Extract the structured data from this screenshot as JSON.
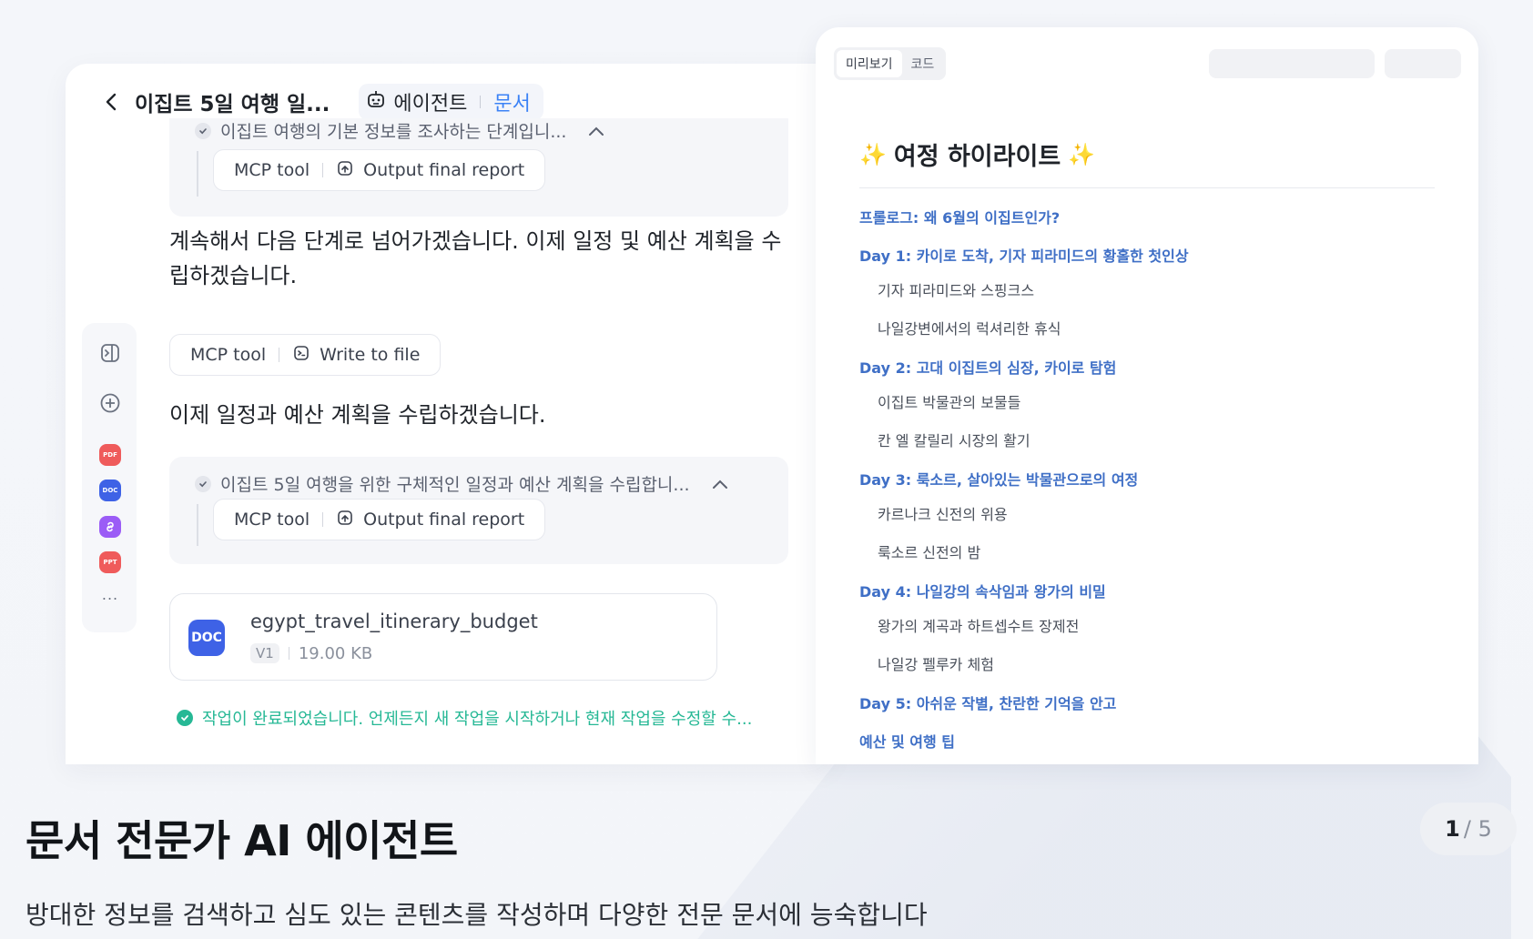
{
  "chat": {
    "title": "이집트 5일 여행 일...",
    "mode_agent": "에이전트",
    "mode_doc": "문서",
    "step1_text": "이집트 여행의 기본 정보를 조사하는 단계입니...",
    "step1_tool": "Output final report",
    "message1": "계속해서 다음 단계로 넘어가겠습니다. 이제 일정 및 예산 계획을 수립하겠습니다.",
    "tool2": "Write to file",
    "message2": "이제 일정과 예산 계획을 수립하겠습니다.",
    "step2_text": "이집트 5일 여행을 위한 구체적인 일정과 예산 계획을 수립합니...",
    "step2_tool": "Output final report",
    "mcp_label": "MCP tool",
    "file": {
      "name": "egypt_travel_itinerary_budget",
      "type": "DOC",
      "version": "V1",
      "size": "19.00 KB"
    },
    "done_text": "작업이 완료되었습니다. 언제든지 새 작업을 시작하거나 현재 작업을 수정할 수..."
  },
  "rail": {
    "files": [
      {
        "label": "PDF",
        "color": "#ef5b5b"
      },
      {
        "label": "DOC",
        "color": "#3e62e6"
      },
      {
        "label": "LINK",
        "color": "#9b5cf6"
      },
      {
        "label": "PPT",
        "color": "#ef5b5b"
      }
    ],
    "more": "..."
  },
  "preview": {
    "tab_preview": "미리보기",
    "tab_code": "코드",
    "title": "여정 하이라이트",
    "toc": [
      {
        "level": 1,
        "text": "프롤로그: 왜 6월의 이집트인가?"
      },
      {
        "level": 1,
        "text": "Day 1: 카이로 도착, 기자 피라미드의 황홀한 첫인상"
      },
      {
        "level": 2,
        "text": "기자 피라미드와 스핑크스"
      },
      {
        "level": 2,
        "text": "나일강변에서의 럭셔리한 휴식"
      },
      {
        "level": 1,
        "text": "Day 2: 고대 이집트의 심장, 카이로 탐험"
      },
      {
        "level": 2,
        "text": "이집트 박물관의 보물들"
      },
      {
        "level": 2,
        "text": "칸 엘 칼릴리 시장의 활기"
      },
      {
        "level": 1,
        "text": "Day 3: 룩소르, 살아있는 박물관으로의 여정"
      },
      {
        "level": 2,
        "text": "카르나크 신전의 위용"
      },
      {
        "level": 2,
        "text": "룩소르 신전의 밤"
      },
      {
        "level": 1,
        "text": "Day 4: 나일강의 속삭임과 왕가의 비밀"
      },
      {
        "level": 2,
        "text": "왕가의 계곡과 하트셉수트 장제전"
      },
      {
        "level": 2,
        "text": "나일강 펠루카 체험"
      },
      {
        "level": 1,
        "text": "Day 5: 아쉬운 작별, 찬란한 기억을 안고"
      },
      {
        "level": 1,
        "text": "예산 및 여행 팁"
      }
    ]
  },
  "caption": {
    "title": "문서 전문가 AI 에이전트",
    "subtitle": "방대한 정보를 검색하고 심도 있는 콘텐츠를 작성하며 다양한 전문 문서에 능숙합니다",
    "page_current": "1",
    "page_total": "/ 5"
  }
}
